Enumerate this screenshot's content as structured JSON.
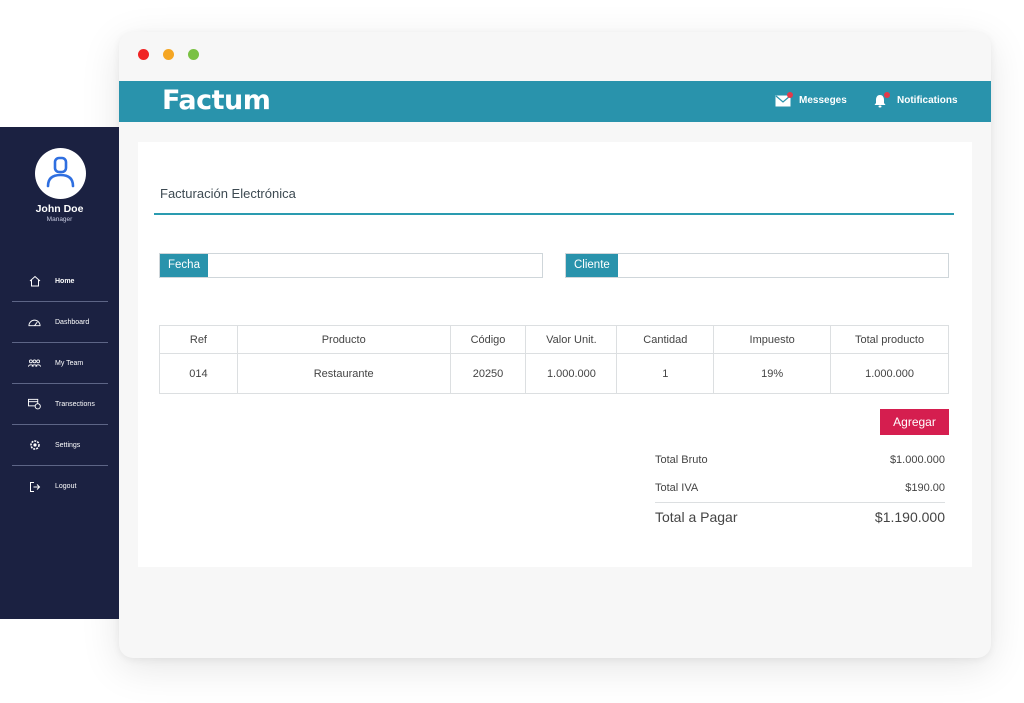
{
  "window": {
    "traffic_lights": [
      "#f02424",
      "#f5a623",
      "#7ac143"
    ]
  },
  "header": {
    "logo": "Factum",
    "messages_label": "Messeges",
    "notifications_label": "Notifications"
  },
  "sidebar": {
    "user_name": "John Doe",
    "user_role": "Manager",
    "items": [
      {
        "label": "Home",
        "icon": "home-icon"
      },
      {
        "label": "Dashboard",
        "icon": "dashboard-icon"
      },
      {
        "label": "My Team",
        "icon": "team-icon"
      },
      {
        "label": "Transections",
        "icon": "transactions-icon"
      },
      {
        "label": "Settings",
        "icon": "gear-icon"
      },
      {
        "label": "Logout",
        "icon": "logout-icon"
      }
    ]
  },
  "main": {
    "title": "Facturación Electrónica",
    "fecha_label": "Fecha",
    "fecha_value": "",
    "cliente_label": "Cliente",
    "cliente_value": "",
    "table": {
      "headers": [
        "Ref",
        "Producto",
        "Código",
        "Valor Unit.",
        "Cantidad",
        "Impuesto",
        "Total producto"
      ],
      "rows": [
        [
          "014",
          "Restaurante",
          "20250",
          "1.000.000",
          "1",
          "19%",
          "1.000.000"
        ]
      ]
    },
    "add_button": "Agregar",
    "totals": {
      "bruto_label": "Total Bruto",
      "bruto_value": "$1.000.000",
      "iva_label": "Total IVA",
      "iva_value": "$190.00",
      "pagar_label": "Total a Pagar",
      "pagar_value": "$1.190.000"
    }
  },
  "colors": {
    "accent": "#2993ac",
    "sidebar": "#1b2141",
    "button": "#d51e4f"
  }
}
